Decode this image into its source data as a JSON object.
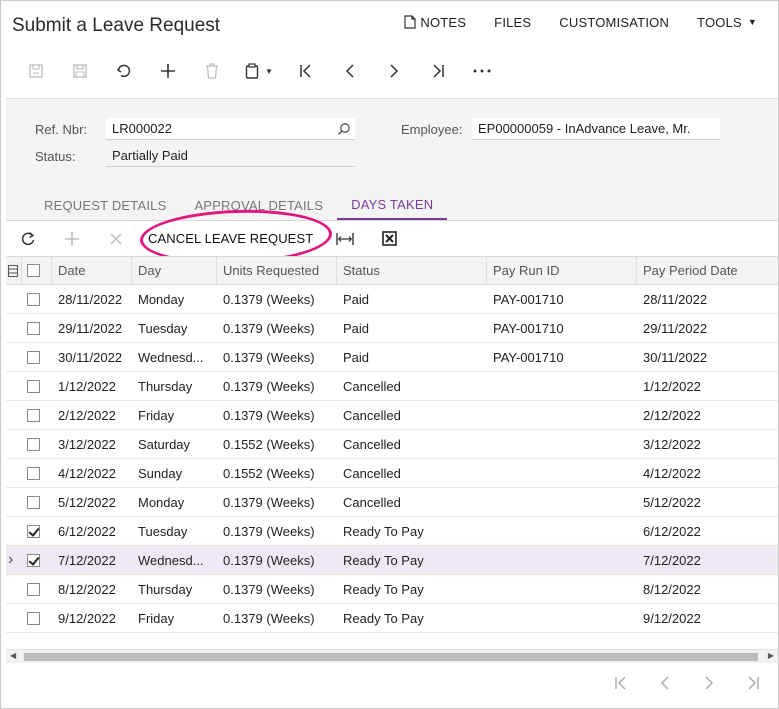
{
  "app": {
    "title": "Submit a Leave Request"
  },
  "top_menu": {
    "notes": "NOTES",
    "files": "FILES",
    "customisation": "CUSTOMISATION",
    "tools": "TOOLS"
  },
  "summary": {
    "ref_label": "Ref. Nbr:",
    "ref_value": "LR000022",
    "status_label": "Status:",
    "status_value": "Partially Paid",
    "employee_label": "Employee:",
    "employee_value": "EP00000059 - InAdvance Leave, Mr."
  },
  "tabs": [
    "REQUEST DETAILS",
    "APPROVAL DETAILS",
    "DAYS TAKEN"
  ],
  "grid_toolbar": {
    "cancel_label": "CANCEL LEAVE REQUEST"
  },
  "grid": {
    "headers": [
      "Date",
      "Day",
      "Units Requested",
      "Status",
      "Pay Run ID",
      "Pay Period Date"
    ],
    "rows": [
      {
        "date": "28/11/2022",
        "day": "Monday",
        "units": "0.1379 (Weeks)",
        "status": "Paid",
        "payrun": "PAY-001710",
        "period": "28/11/2022",
        "checked": false
      },
      {
        "date": "29/11/2022",
        "day": "Tuesday",
        "units": "0.1379 (Weeks)",
        "status": "Paid",
        "payrun": "PAY-001710",
        "period": "29/11/2022",
        "checked": false
      },
      {
        "date": "30/11/2022",
        "day": "Wednesd...",
        "units": "0.1379 (Weeks)",
        "status": "Paid",
        "payrun": "PAY-001710",
        "period": "30/11/2022",
        "checked": false
      },
      {
        "date": "1/12/2022",
        "day": "Thursday",
        "units": "0.1379 (Weeks)",
        "status": "Cancelled",
        "payrun": "",
        "period": "1/12/2022",
        "checked": false
      },
      {
        "date": "2/12/2022",
        "day": "Friday",
        "units": "0.1379 (Weeks)",
        "status": "Cancelled",
        "payrun": "",
        "period": "2/12/2022",
        "checked": false
      },
      {
        "date": "3/12/2022",
        "day": "Saturday",
        "units": "0.1552 (Weeks)",
        "status": "Cancelled",
        "payrun": "",
        "period": "3/12/2022",
        "checked": false
      },
      {
        "date": "4/12/2022",
        "day": "Sunday",
        "units": "0.1552 (Weeks)",
        "status": "Cancelled",
        "payrun": "",
        "period": "4/12/2022",
        "checked": false
      },
      {
        "date": "5/12/2022",
        "day": "Monday",
        "units": "0.1379 (Weeks)",
        "status": "Cancelled",
        "payrun": "",
        "period": "5/12/2022",
        "checked": false
      },
      {
        "date": "6/12/2022",
        "day": "Tuesday",
        "units": "0.1379 (Weeks)",
        "status": "Ready To Pay",
        "payrun": "",
        "period": "6/12/2022",
        "checked": true
      },
      {
        "date": "7/12/2022",
        "day": "Wednesd...",
        "units": "0.1379 (Weeks)",
        "status": "Ready To Pay",
        "payrun": "",
        "period": "7/12/2022",
        "checked": true,
        "selected": true
      },
      {
        "date": "8/12/2022",
        "day": "Thursday",
        "units": "0.1379 (Weeks)",
        "status": "Ready To Pay",
        "payrun": "",
        "period": "8/12/2022",
        "checked": false
      },
      {
        "date": "9/12/2022",
        "day": "Friday",
        "units": "0.1379 (Weeks)",
        "status": "Ready To Pay",
        "payrun": "",
        "period": "9/12/2022",
        "checked": false
      }
    ]
  },
  "colors": {
    "accent": "#7a3d9c",
    "highlight": "#e0177e",
    "selected_row": "#f1e8f5"
  }
}
